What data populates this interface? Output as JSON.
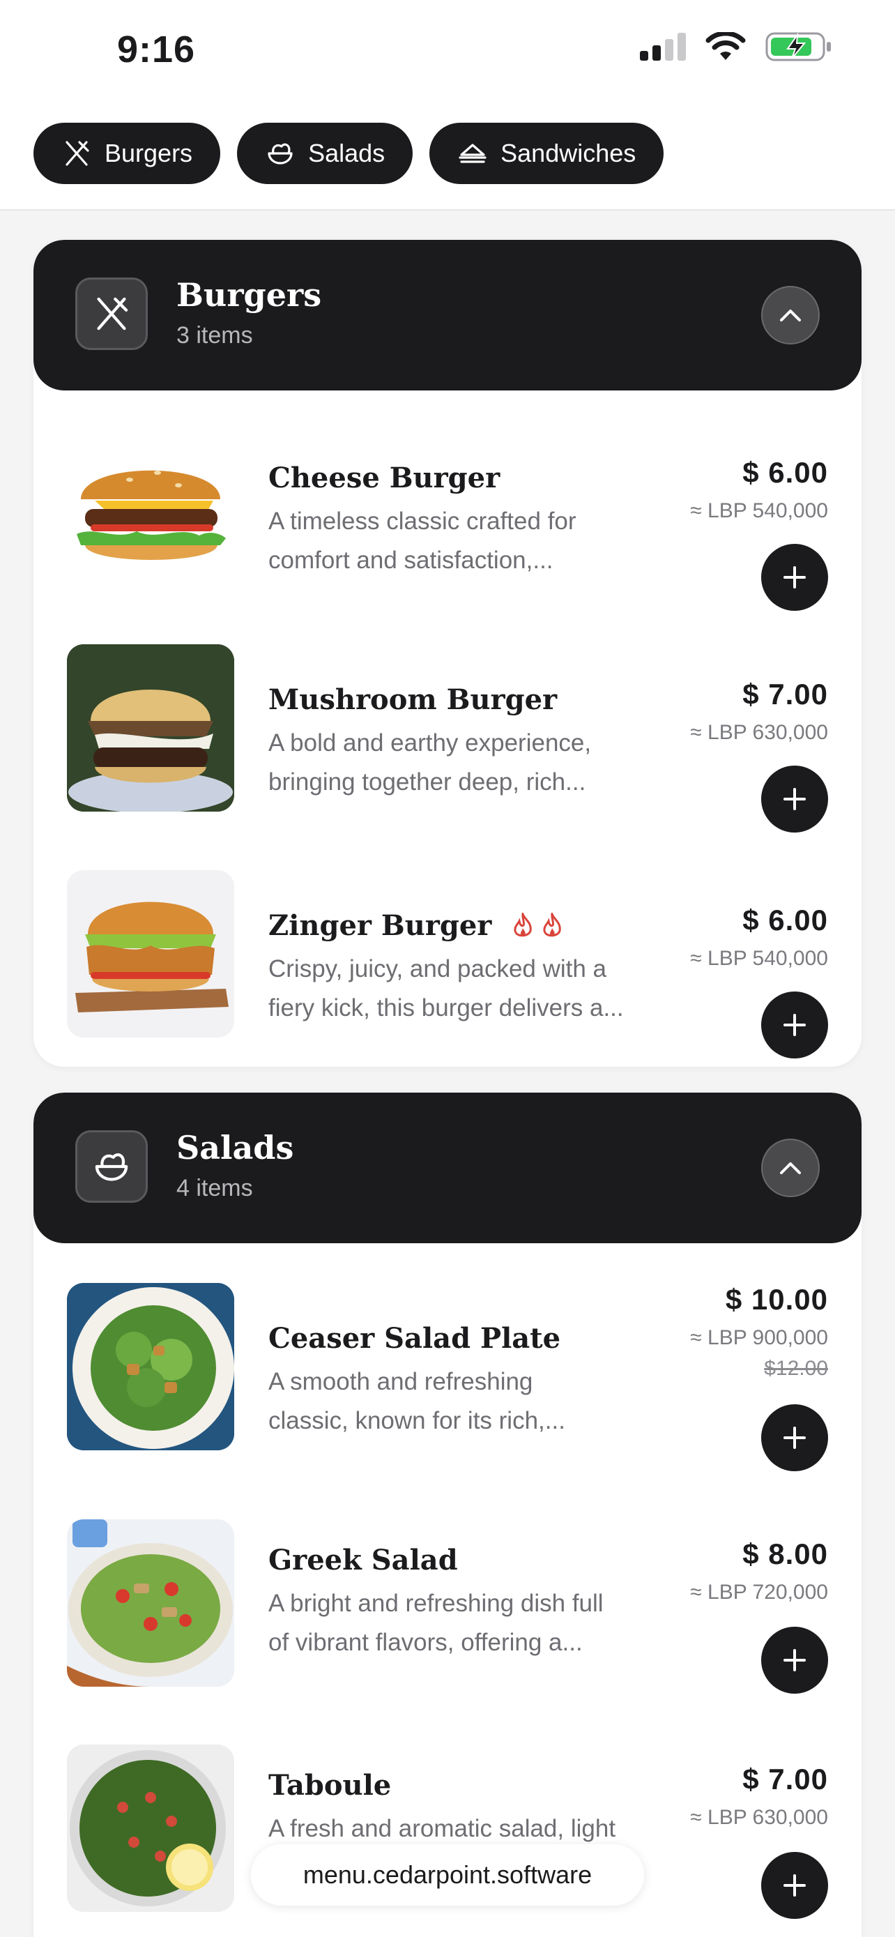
{
  "status": {
    "time": "9:16"
  },
  "chips": [
    {
      "label": "Burgers",
      "icon": "utensils-crossed-icon"
    },
    {
      "label": "Salads",
      "icon": "salad-bowl-icon"
    },
    {
      "label": "Sandwiches",
      "icon": "sandwich-icon"
    }
  ],
  "sections": [
    {
      "title": "Burgers",
      "count": "3 items",
      "icon": "utensils-crossed-icon",
      "items": [
        {
          "name": "Cheese Burger",
          "desc_line1": "A timeless classic crafted for",
          "desc_line2": "comfort and satisfaction,...",
          "price": "$ 6.00",
          "lbp": "≈ LBP 540,000"
        },
        {
          "name": "Mushroom Burger",
          "desc_line1": "A bold and earthy experience,",
          "desc_line2": "bringing together deep, rich...",
          "price": "$ 7.00",
          "lbp": "≈ LBP 630,000"
        },
        {
          "name": "Zinger Burger",
          "desc_line1": "Crispy, juicy, and packed with a",
          "desc_line2": "fiery kick, this burger delivers a...",
          "price": "$ 6.00",
          "lbp": "≈ LBP 540,000",
          "spicy_level": 2
        }
      ]
    },
    {
      "title": "Salads",
      "count": "4 items",
      "icon": "salad-bowl-icon",
      "items": [
        {
          "name": "Ceaser Salad Plate",
          "desc_line1": "A smooth and refreshing",
          "desc_line2": "classic, known for its rich,...",
          "price": "$ 10.00",
          "lbp": "≈ LBP 900,000",
          "old_price": "$12.00"
        },
        {
          "name": "Greek Salad",
          "desc_line1": "A bright and refreshing dish full",
          "desc_line2": "of vibrant flavors, offering a...",
          "price": "$ 8.00",
          "lbp": "≈ LBP 720,000"
        },
        {
          "name": "Taboule",
          "desc_line1": "A fresh and aromatic salad, light",
          "desc_line2": "",
          "price": "$ 7.00",
          "lbp": "≈ LBP 630,000"
        }
      ]
    }
  ],
  "url": "menu.cedarpoint.software",
  "colors": {
    "dark": "#1b1b1d",
    "spicy": "#d9443a",
    "battery": "#34c759"
  }
}
